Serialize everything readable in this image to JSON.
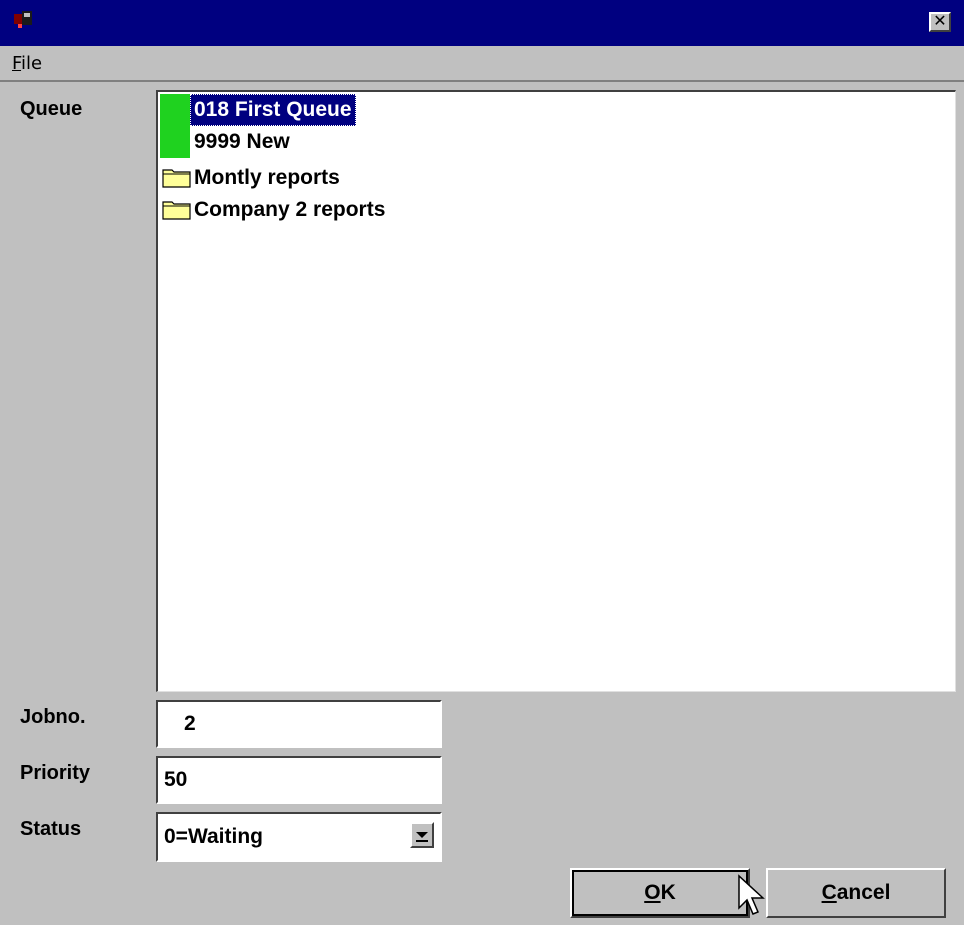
{
  "titlebar": {
    "close_label": "✕",
    "app_icon": "app-icon"
  },
  "menu": {
    "file_underlined": "F",
    "file_rest": "ile"
  },
  "labels": {
    "queue": "Queue",
    "jobno": "Jobno.",
    "priority": "Priority",
    "status": "Status"
  },
  "queue_list": [
    {
      "text": "018 First Queue",
      "type": "queue",
      "selected": true,
      "color": "#1fd21f"
    },
    {
      "text": "9999 New",
      "type": "queue",
      "selected": false,
      "color": "#1fd21f"
    },
    {
      "text": "Montly reports",
      "type": "folder",
      "icon": "folder-icon"
    },
    {
      "text": "Company 2 reports",
      "type": "folder",
      "icon": "folder-icon"
    }
  ],
  "fields": {
    "jobno": "2",
    "priority": "50",
    "status": "0=Waiting"
  },
  "buttons": {
    "ok_underlined": "O",
    "ok_rest": "K",
    "cancel_underlined": "C",
    "cancel_rest": "ancel"
  },
  "colors": {
    "titlebar": "#000080",
    "selection": "#000080",
    "window": "#c0c0c0"
  }
}
